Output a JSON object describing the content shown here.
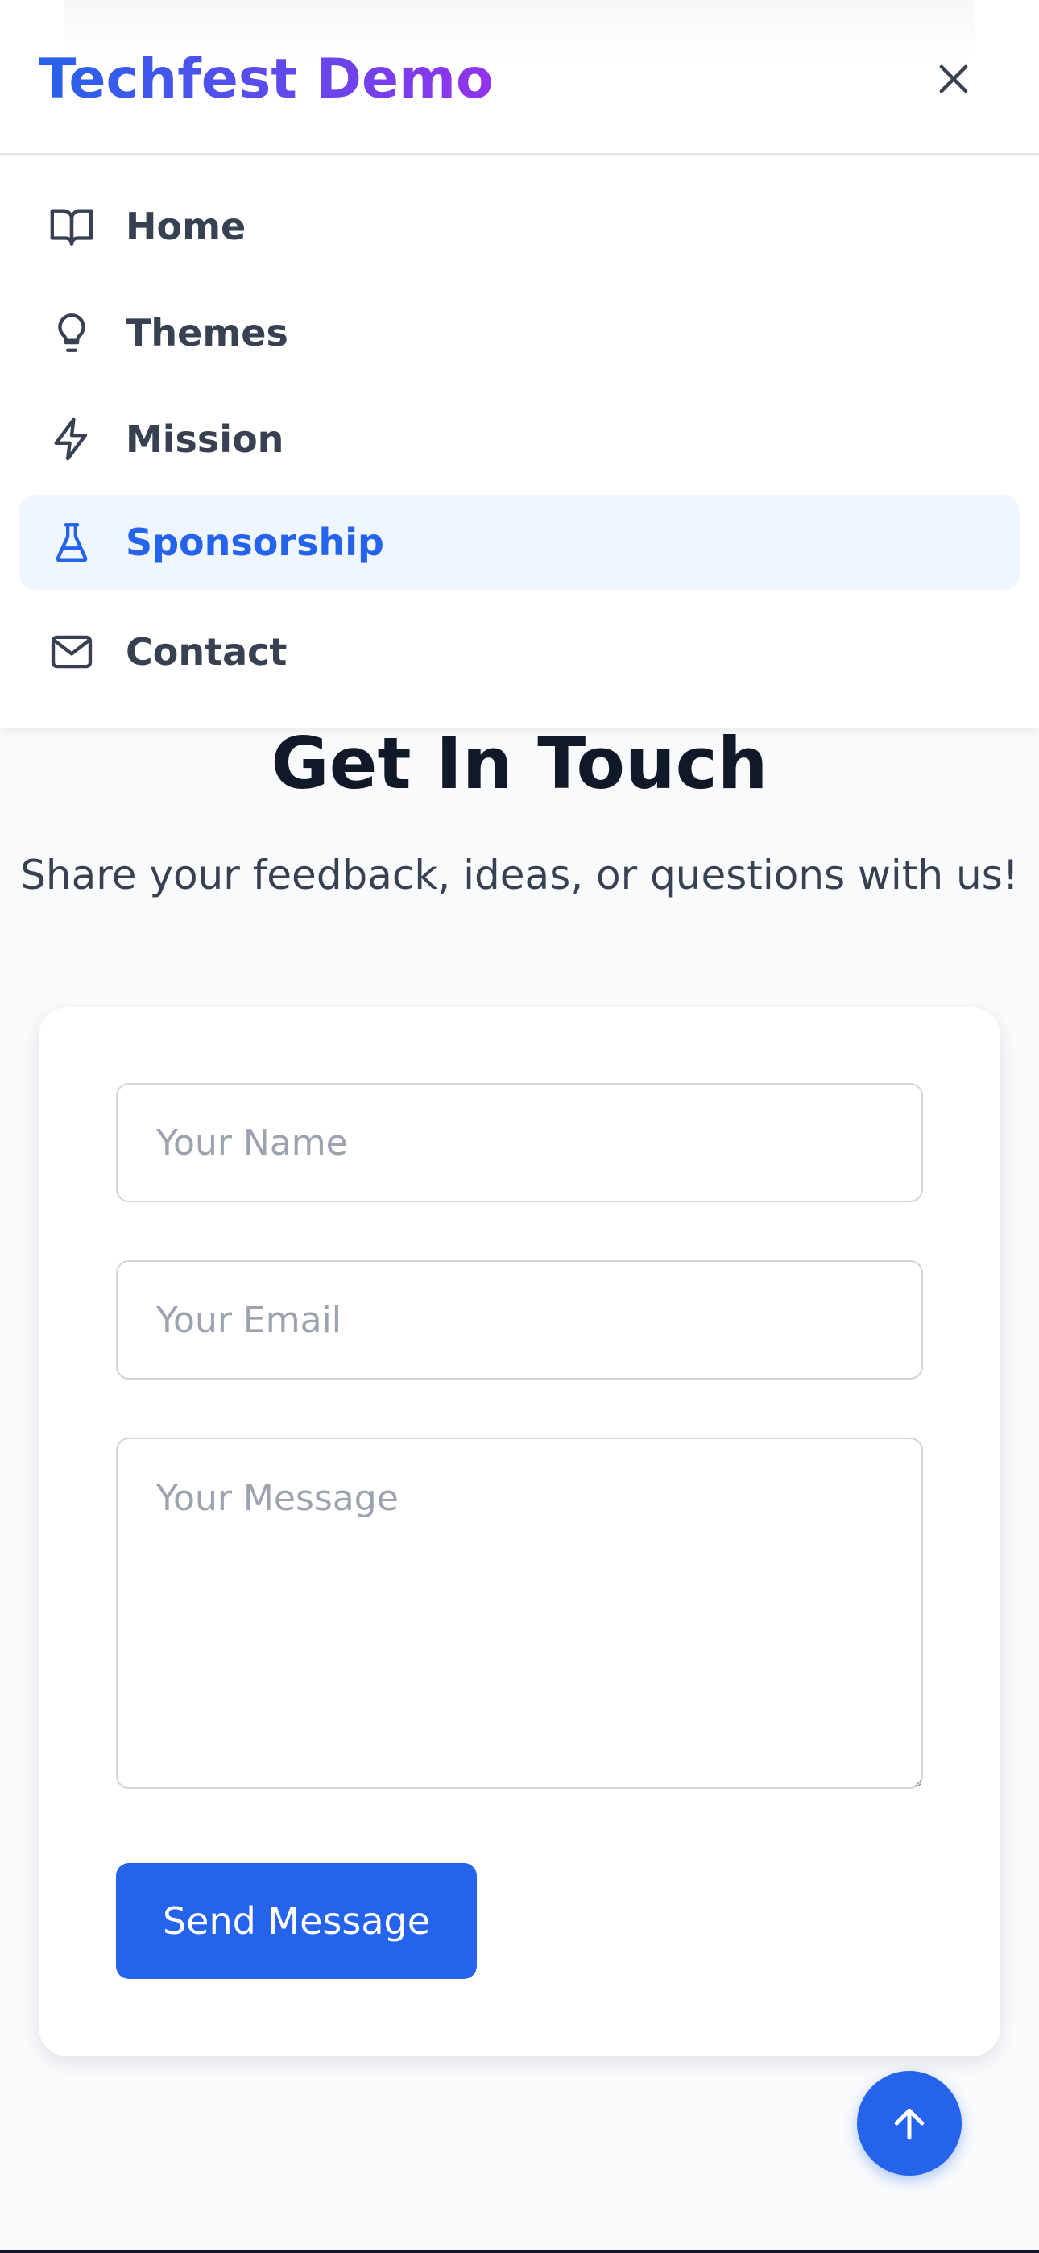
{
  "header": {
    "brand": "Techfest Demo",
    "close_icon": "close-icon"
  },
  "nav": {
    "items": [
      {
        "label": "Home",
        "icon": "book-open-icon",
        "active": false
      },
      {
        "label": "Themes",
        "icon": "lightbulb-icon",
        "active": false
      },
      {
        "label": "Mission",
        "icon": "lightning-icon",
        "active": false
      },
      {
        "label": "Sponsorship",
        "icon": "flask-icon",
        "active": true
      },
      {
        "label": "Contact",
        "icon": "mail-icon",
        "active": false
      }
    ]
  },
  "contact": {
    "title": "Get In Touch",
    "subtitle": "Share your feedback, ideas, or questions with us!",
    "name_placeholder": "Your Name",
    "email_placeholder": "Your Email",
    "message_placeholder": "Your Message",
    "submit_label": "Send Message"
  },
  "scroll_top": {
    "icon": "arrow-up-icon"
  },
  "colors": {
    "accent": "#2563eb",
    "brand_gradient_start": "#2563eb",
    "brand_gradient_end": "#9333ea",
    "active_nav_bg": "#eff6ff",
    "page_bg": "#f8fafc"
  }
}
